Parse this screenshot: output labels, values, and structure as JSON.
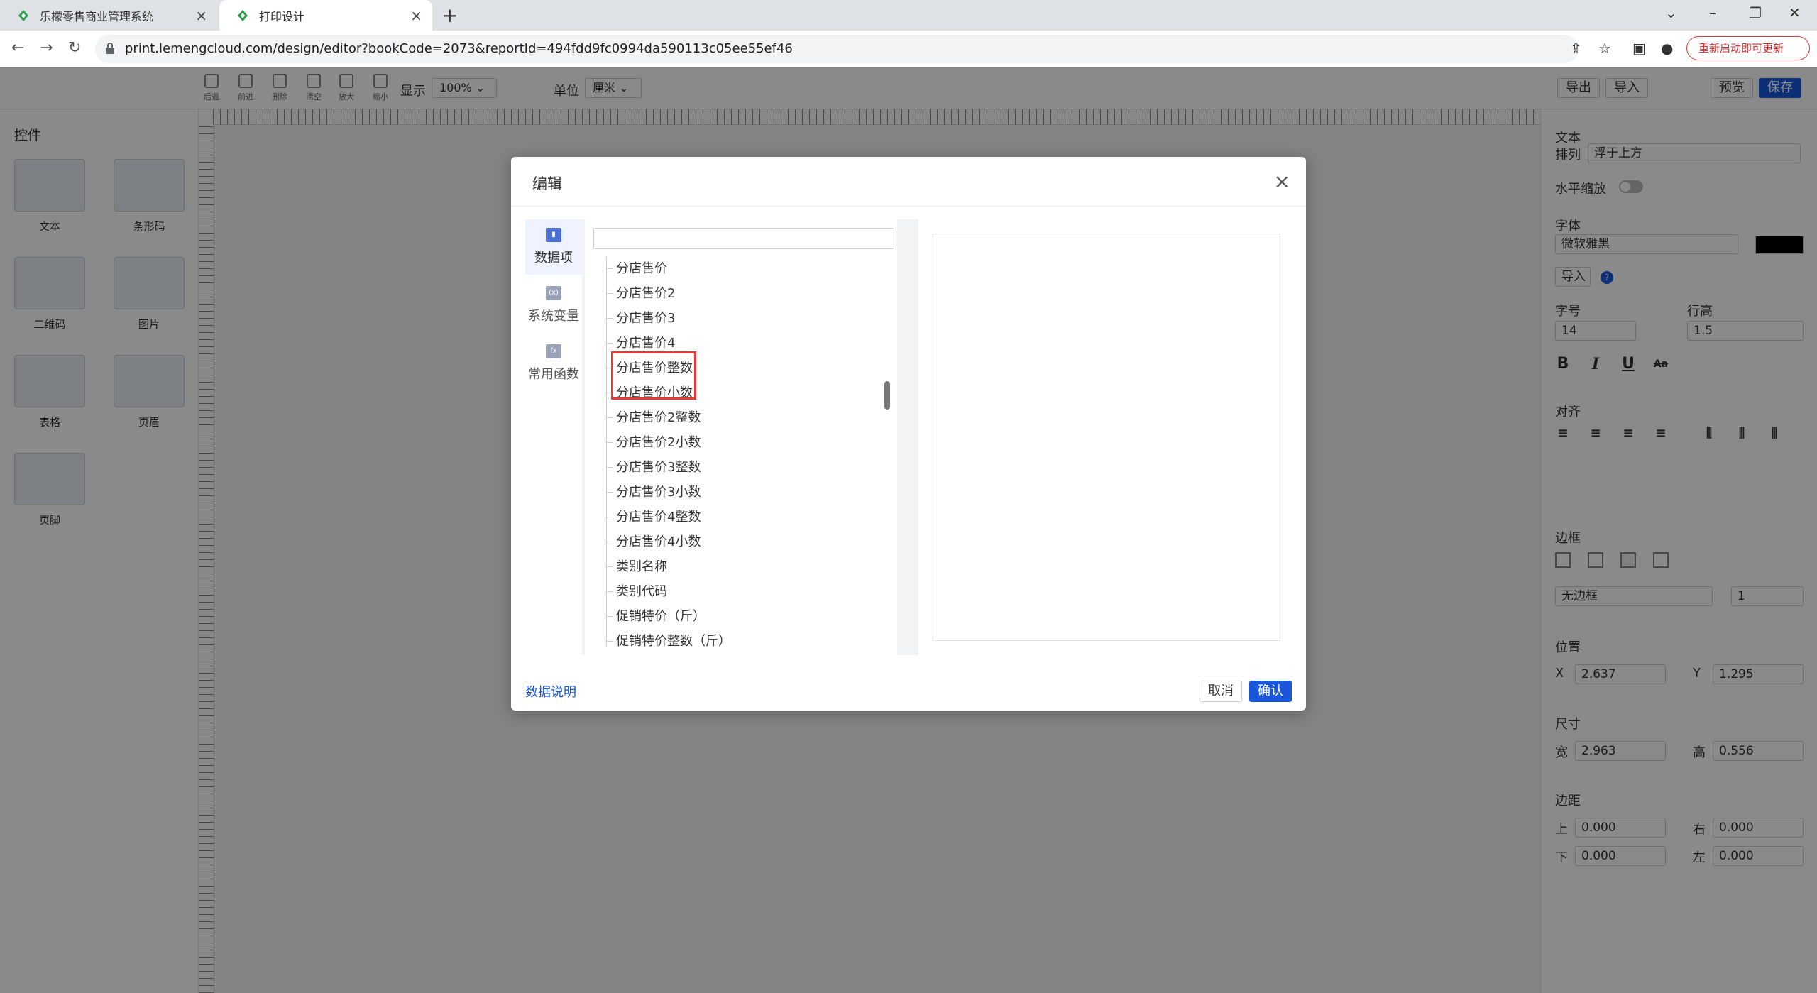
{
  "browser": {
    "tabs": [
      {
        "title": "乐檬零售商业管理系统",
        "active": false
      },
      {
        "title": "打印设计",
        "active": true
      }
    ],
    "url": "print.lemengcloud.com/design/editor?bookCode=2073&reportId=494fdd9fc0994da590113c05ee55ef46",
    "update_label": "重新启动即可更新"
  },
  "toolbar": {
    "undo": "后退",
    "redo": "前进",
    "delete": "删除",
    "clear": "清空",
    "zoom_in": "放大",
    "zoom_out": "缩小",
    "display_label": "显示",
    "display_value": "100%",
    "unit_label": "单位",
    "unit_value": "厘米",
    "export": "导出",
    "import": "导入",
    "preview": "预览",
    "save": "保存"
  },
  "left_panel": {
    "title": "控件",
    "controls": [
      "文本",
      "条形码",
      "二维码",
      "图片",
      "表格",
      "页眉",
      "页脚"
    ]
  },
  "right_panel": {
    "text_title": "文本",
    "arrange_label": "排列",
    "arrange_value": "浮于上方",
    "hscale_label": "水平缩放",
    "font_label": "字体",
    "font_value": "微软雅黑",
    "import_label": "导入",
    "size_label": "字号",
    "size_value": "14",
    "lineheight_label": "行高",
    "lineheight_value": "1.5",
    "align_label": "对齐",
    "border_label": "边框",
    "border_value": "无边框",
    "border_width": "1",
    "position_label": "位置",
    "x_label": "X",
    "x_value": "2.637",
    "y_label": "Y",
    "y_value": "1.295",
    "dimension_label": "尺寸",
    "width_label": "宽",
    "width_value": "2.963",
    "height_label": "高",
    "height_value": "0.556",
    "margin_label": "边距",
    "top_label": "上",
    "top_value": "0.000",
    "right_label": "右",
    "right_value": "0.000",
    "bottom_label": "下",
    "bottom_value": "0.000",
    "left_label": "左",
    "left_value": "0.000"
  },
  "modal": {
    "title": "编辑",
    "side_tabs": [
      "数据项",
      "系统变量",
      "常用函数"
    ],
    "tree_items": [
      "分店售价",
      "分店售价2",
      "分店售价3",
      "分店售价4",
      "分店售价整数",
      "分店售价小数",
      "分店售价2整数",
      "分店售价2小数",
      "分店售价3整数",
      "分店售价3小数",
      "分店售价4整数",
      "分店售价4小数",
      "类别名称",
      "类别代码",
      "促销特价（斤）",
      "促销特价整数（斤）"
    ],
    "data_desc": "数据说明",
    "cancel": "取消",
    "confirm": "确认"
  },
  "colors": {
    "primary": "#1a56db",
    "highlight": "#e53935"
  }
}
